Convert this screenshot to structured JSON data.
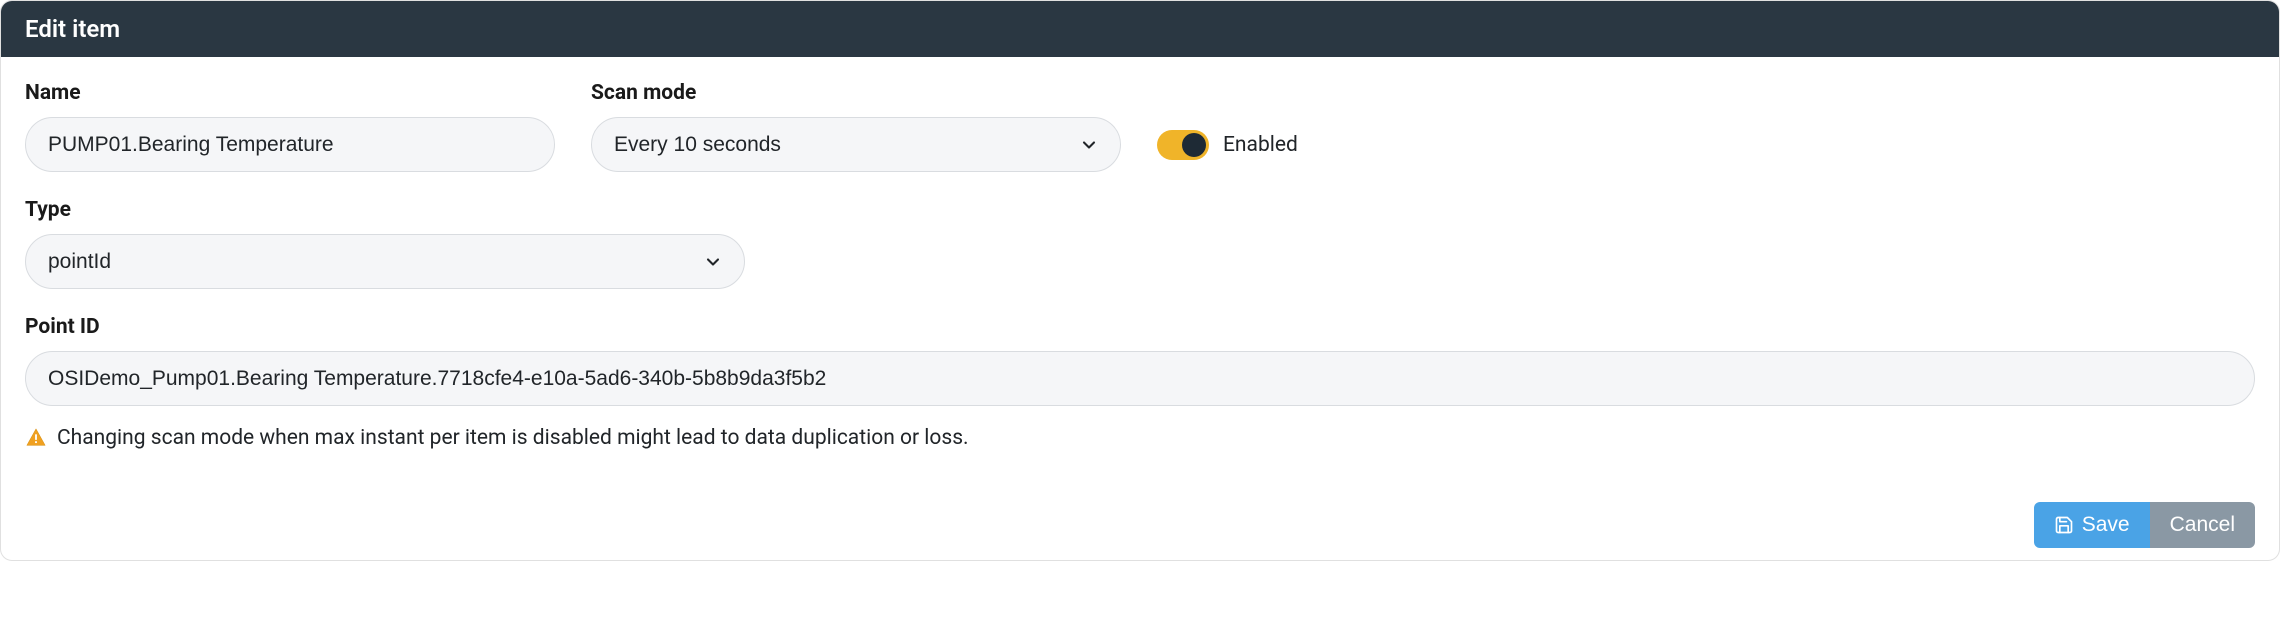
{
  "header": {
    "title": "Edit item"
  },
  "fields": {
    "name": {
      "label": "Name",
      "value": "PUMP01.Bearing Temperature"
    },
    "scanMode": {
      "label": "Scan mode",
      "value": "Every 10 seconds"
    },
    "enabled": {
      "label": "Enabled",
      "value": true
    },
    "type": {
      "label": "Type",
      "value": "pointId"
    },
    "pointId": {
      "label": "Point ID",
      "value": "OSIDemo_Pump01.Bearing Temperature.7718cfe4-e10a-5ad6-340b-5b8b9da3f5b2"
    }
  },
  "warning": {
    "text": "Changing scan mode when max instant per item is disabled might lead to data duplication or loss."
  },
  "footer": {
    "save": "Save",
    "cancel": "Cancel"
  },
  "colors": {
    "headerBg": "#2a3742",
    "toggleOn": "#f0b429",
    "saveBtn": "#4aa3e6",
    "cancelBtn": "#8a98a4",
    "warningIcon": "#f0a020"
  }
}
